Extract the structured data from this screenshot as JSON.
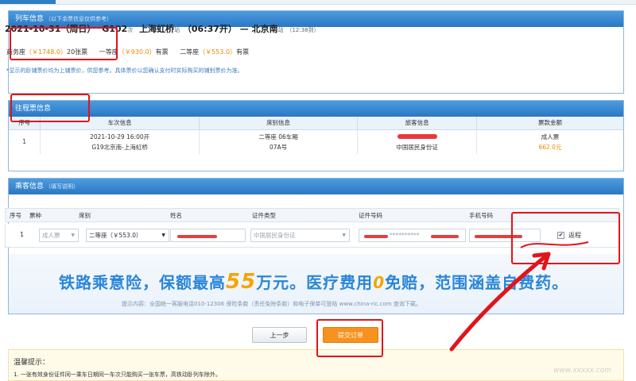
{
  "train_info": {
    "header": "列车信息",
    "header_note": "（以下余票信息仅供参考）",
    "date": "2021-10-31（周日）",
    "train_no": "G102",
    "train_suffix": "次",
    "from_station": "上海虹桥",
    "station_suffix": "站",
    "depart": "（06:37开）",
    "arrow": "—",
    "to_station": "北京南",
    "arrive": "（12:38到）",
    "seats": [
      {
        "name": "商务座",
        "price": "（￥1748.0）",
        "left": "20张票"
      },
      {
        "name": "一等座",
        "price": "（￥930.0）",
        "left": "有票"
      },
      {
        "name": "二等座",
        "price": "（￥553.0）",
        "left": "有票"
      }
    ],
    "note": "*显示的卧铺票价均为上铺票价，供您参考。具体票价以您确认支付时实际购买的铺别票价为准。"
  },
  "outbound": {
    "header": "往程票信息",
    "columns": [
      "序号",
      "车次信息",
      "席别信息",
      "旅客信息",
      "票款金额"
    ],
    "row": {
      "index": "1",
      "train_line1": "2021-10-29 16:00开",
      "train_line2": "G19北京南-上海虹桥",
      "seat_line1": "二等座 06车厢",
      "seat_line2": "07A号",
      "passenger_id_type": "中国居民身份证",
      "ticket_type": "成人票",
      "amount": "662.0元"
    }
  },
  "passengers": {
    "header": "乘客信息",
    "header_note": "（填写说明）",
    "columns": [
      "序号",
      "票种",
      "席别",
      "姓名",
      "证件类型",
      "证件号码",
      "手机号码"
    ],
    "row": {
      "index": "1",
      "ticket_type": "成人票",
      "seat": "二等座（￥553.0）",
      "id_type": "中国居民身份证",
      "id_number_masked": "**********",
      "return_label": "返程"
    }
  },
  "insurance": {
    "part1": "铁路乘意险，保额最高",
    "amount": "55",
    "part2": "万元。医疗费用",
    "zero": "0",
    "part3": "免赔，范围涵盖自费药。",
    "sub": "提示内容：全国统一客服电话010-12306  保险条款（责任免除条款）和电子保单可登陆 www.china-ric.com 查询下载。"
  },
  "buttons": {
    "prev": "上一步",
    "submit": "提交订单"
  },
  "tips": {
    "title": "温馨提示：",
    "item1": "1. 一张有效身份证件同一乘车日期同一车次只能购买一张车票，高铁动卧列车除外。"
  },
  "watermark": "www.xxxxx.com"
}
